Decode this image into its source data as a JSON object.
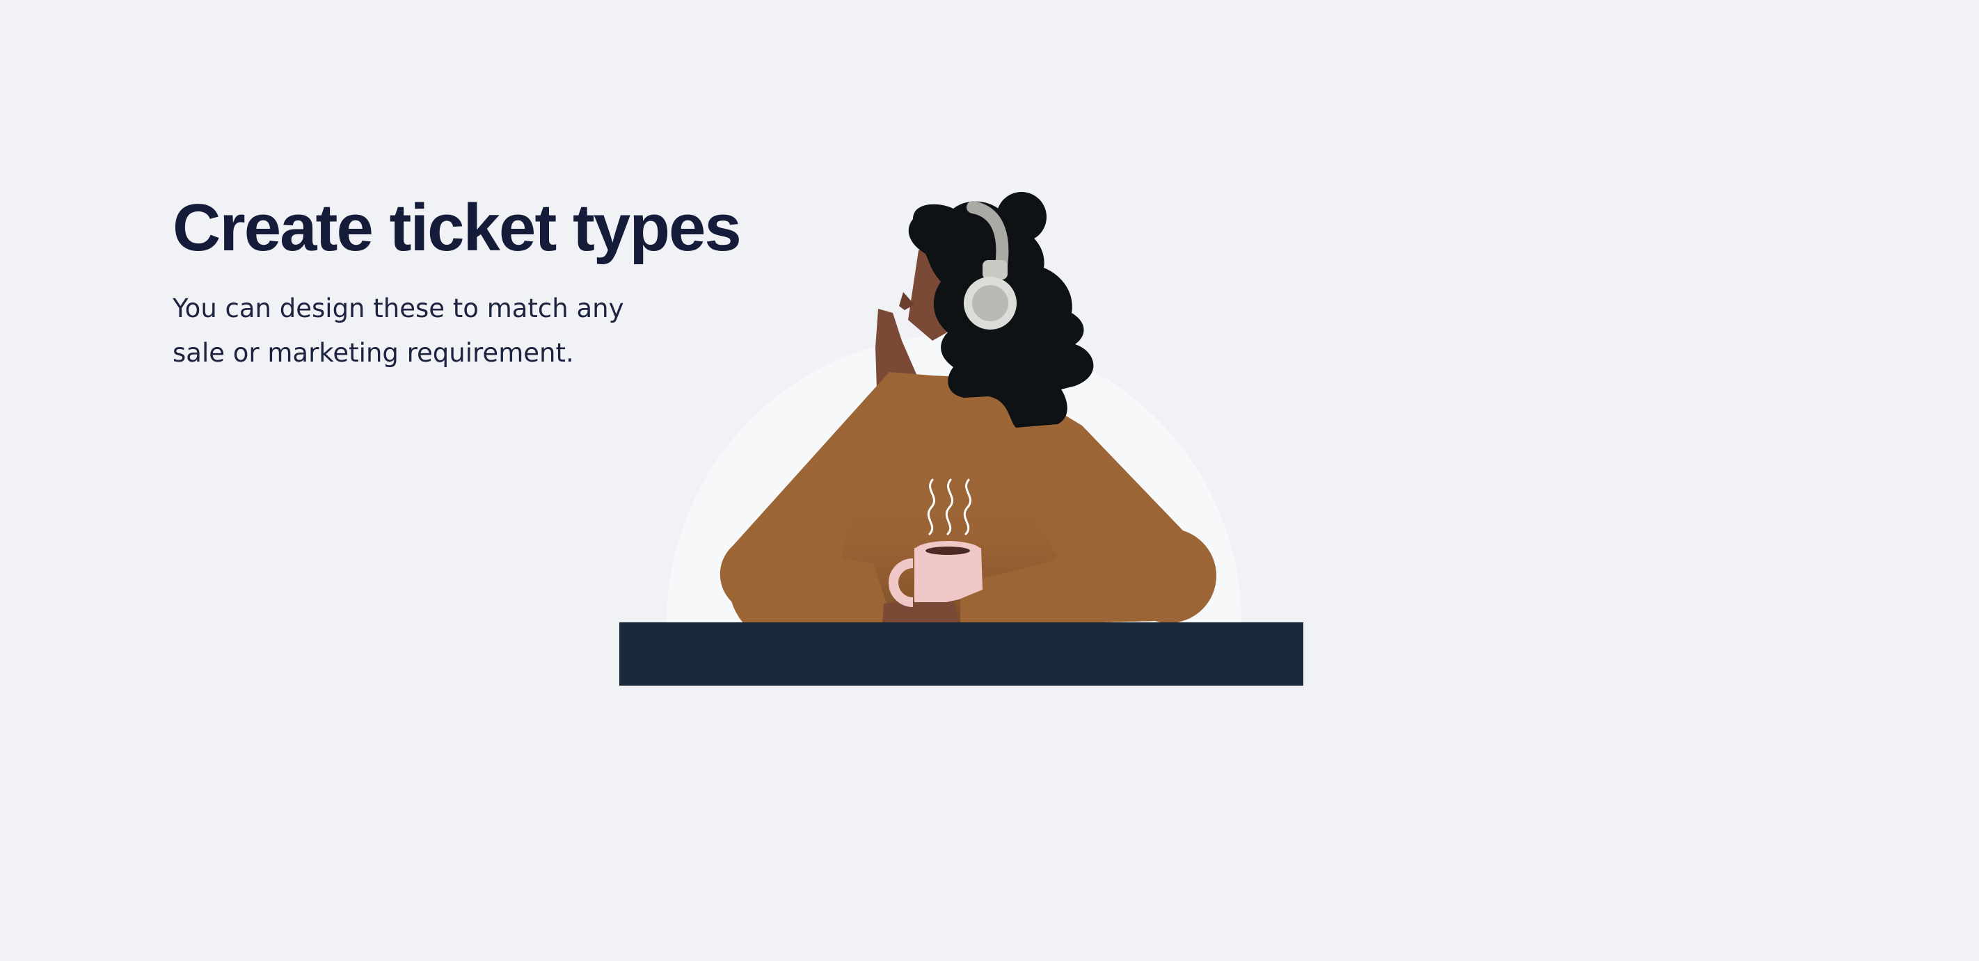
{
  "hero": {
    "title": "Create ticket types",
    "subtitle": "You can design these to match any sale or marketing requirement."
  },
  "illustration": {
    "icon": "person-with-headphones-and-coffee-icon",
    "colors": {
      "background": "#f1f2f6",
      "halo": "#f7f8fa",
      "desk": "#1b2a3a",
      "sweater": "#9c6536",
      "skin": "#7a4a36",
      "hair": "#0f1215",
      "headphones": "#b9bab3",
      "mug": "#f1c8c8"
    }
  }
}
